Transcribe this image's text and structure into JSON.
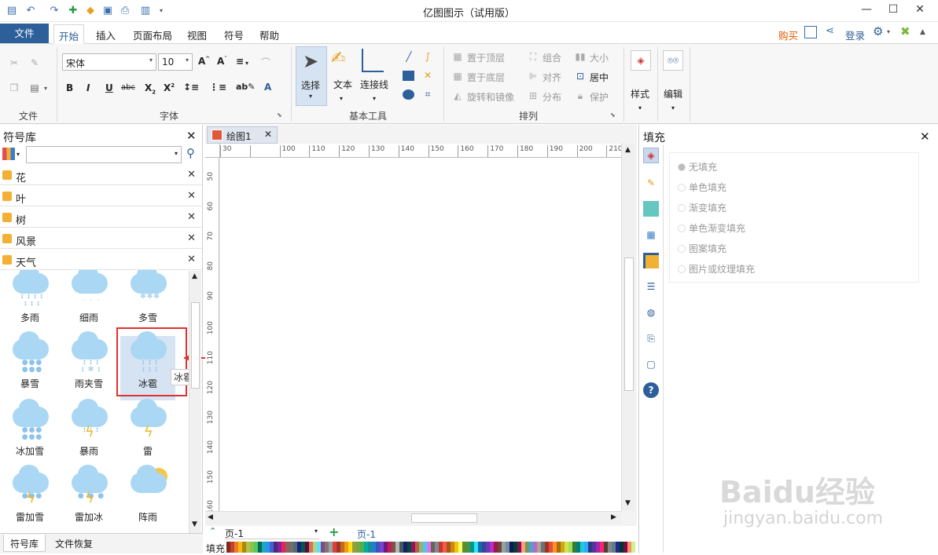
{
  "app": {
    "title": "亿图图示（试用版）"
  },
  "window": {
    "minimize": "—",
    "maximize": "☐",
    "close": "✕"
  },
  "ribbon_tabs": {
    "file": "文件",
    "items": [
      "开始",
      "插入",
      "页面布局",
      "视图",
      "符号",
      "帮助"
    ]
  },
  "account": {
    "buy": "购买",
    "login": "登录"
  },
  "ribbon": {
    "font_name": "宋体",
    "font_size": "10",
    "groups": {
      "file": "文件",
      "font": "字体",
      "basic_tools": "基本工具",
      "arrange": "排列"
    },
    "tools": {
      "select": "选择",
      "text": "文本",
      "connector": "连接线",
      "style": "样式",
      "edit": "编辑"
    },
    "arrange": {
      "bring_top": "置于顶层",
      "send_bottom": "置于底层",
      "rotate_mirror": "旋转和镜像",
      "group": "组合",
      "align": "对齐",
      "distribute": "分布",
      "size": "大小",
      "center": "居中",
      "protect": "保护"
    }
  },
  "symbol_library": {
    "title": "符号库",
    "categories": [
      "花",
      "叶",
      "树",
      "风景",
      "天气"
    ],
    "symbols": [
      {
        "name": "多雨",
        "kind": "rain"
      },
      {
        "name": "细雨",
        "kind": "drizzle"
      },
      {
        "name": "多雪",
        "kind": "snow"
      },
      {
        "name": "暴雪",
        "kind": "blizzard"
      },
      {
        "name": "雨夹雪",
        "kind": "sleet"
      },
      {
        "name": "冰雹",
        "kind": "hail"
      },
      {
        "name": "冰加雪",
        "kind": "icesnow"
      },
      {
        "name": "暴雨",
        "kind": "storm"
      },
      {
        "name": "雷",
        "kind": "thunder"
      },
      {
        "name": "雷加雪",
        "kind": "thundersnow"
      },
      {
        "name": "雷加冰",
        "kind": "thunderice"
      },
      {
        "name": "阵雨",
        "kind": "shower"
      }
    ],
    "tooltip": "冰雹",
    "bottom_tabs": [
      "符号库",
      "文件恢复"
    ]
  },
  "document": {
    "tab": "绘图1",
    "h_ruler": [
      "30",
      "",
      "100",
      "110",
      "120",
      "130",
      "140",
      "150",
      "160",
      "170",
      "180",
      "190",
      "200",
      "210"
    ],
    "v_ruler": [
      "50",
      "60",
      "70",
      "80",
      "90",
      "100",
      "110",
      "120",
      "130",
      "140",
      "150",
      "160"
    ],
    "page_select": "页-1",
    "page_tab": "页-1",
    "fill_label": "填充"
  },
  "fill_panel": {
    "title": "填充",
    "options": [
      "无填充",
      "单色填充",
      "渐变填充",
      "单色渐变填充",
      "图案填充",
      "图片或纹理填充"
    ]
  },
  "watermark": {
    "brand": "Baidu经验",
    "url": "jingyan.baidu.com"
  },
  "colors": {
    "accent": "#2d5f9a",
    "highlight_red": "#e03030",
    "cloud": "#a9d7f4",
    "bolt": "#f2b51c"
  }
}
